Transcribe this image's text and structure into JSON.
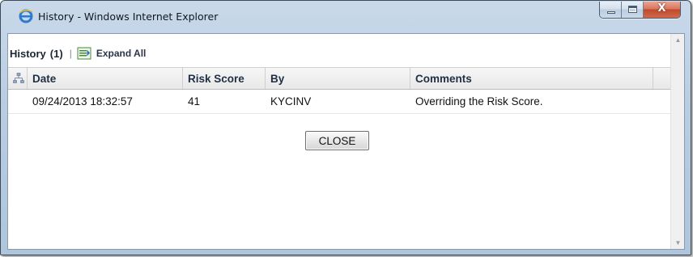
{
  "window": {
    "title": "History - Windows Internet Explorer",
    "icons": {
      "app": "internet-explorer-icon",
      "minimize": "minimize-icon",
      "maximize": "maximize-icon",
      "close": "close-icon"
    },
    "close_glyph": "X"
  },
  "toolbar": {
    "title": "History",
    "count": "(1)",
    "separator": "|",
    "expand_icon": "expand-all-icon",
    "expand_label": "Expand All"
  },
  "grid": {
    "header_icon": "tree-hierarchy-icon",
    "columns": [
      "Date",
      "Risk Score",
      "By",
      "Comments"
    ],
    "rows": [
      [
        "09/24/2013 18:32:57",
        "41",
        "KYCINV",
        "Overriding the Risk Score."
      ]
    ]
  },
  "actions": {
    "close_label": "CLOSE"
  },
  "colors": {
    "title_bar": "#b9cde2",
    "close_button_red": "#c04a2e",
    "header_text": "#1f2f44"
  }
}
